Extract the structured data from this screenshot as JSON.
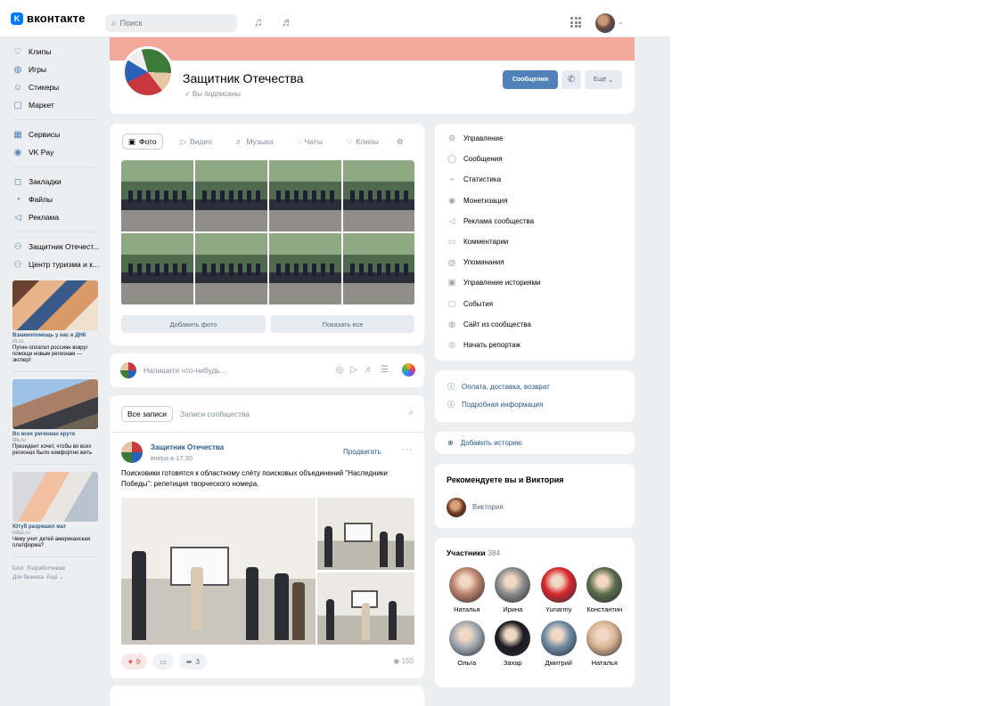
{
  "header": {
    "logo_mark": "K",
    "logo_text": "вконтакте",
    "search_placeholder": "Поиск"
  },
  "sidebar": {
    "items": [
      {
        "label": "Клипы",
        "icon": "clips-icon"
      },
      {
        "label": "Игры",
        "icon": "gamepad-icon"
      },
      {
        "label": "Стикеры",
        "icon": "sticker-icon"
      },
      {
        "label": "Маркет",
        "icon": "bag-icon"
      },
      {
        "label": "Сервисы",
        "icon": "grid-icon"
      },
      {
        "label": "VK Pay",
        "icon": "pay-icon"
      },
      {
        "label": "Закладки",
        "icon": "bookmark-icon"
      },
      {
        "label": "Файлы",
        "icon": "file-icon"
      },
      {
        "label": "Реклама",
        "icon": "megaphone-icon"
      },
      {
        "label": "Защитник Отечест...",
        "icon": "group-icon"
      },
      {
        "label": "Центр туризма и к...",
        "icon": "group-icon"
      }
    ],
    "ads": [
      {
        "title": "Взаимопомощь у нас в ДНК",
        "host": "rb.ru",
        "desc": "Путин оплатил россиян вокруг помощи новым регионам — эксперт"
      },
      {
        "title": "Во всех регионах круто",
        "host": "life.ru",
        "desc": "Президент хочет, чтобы во всех регионах было комфортно жить"
      },
      {
        "title": "Ютуб разрешил мат",
        "host": "ridus.ru",
        "desc": "Чему учит детей американская платформа?"
      }
    ],
    "footer": [
      "Блог",
      "Разработчикам",
      "Для бизнеса",
      "Ещё"
    ]
  },
  "group": {
    "name": "Защитник Отечества",
    "subscribed": "✓ Вы подписаны",
    "message_button": "Сообщения",
    "more_button": "Ещё"
  },
  "media_tabs": [
    "Фото",
    "Видео",
    "Музыка",
    "Чаты",
    "Клипы"
  ],
  "photos_buttons": {
    "add": "Добавить фото",
    "show_all": "Показать все"
  },
  "composer": {
    "placeholder": "Напишите что-нибудь..."
  },
  "wall": {
    "tab_all": "Все записи",
    "tab_community": "Записи сообщества",
    "post": {
      "author": "Защитник Отечества",
      "time": "вчера в 17:30",
      "promote": "Продвигать",
      "text": "Поисковики готовятся к областному слёту поисковых объединений \"Наследники Победы\": репетиция творческого номера.",
      "likes": "9",
      "shares": "3",
      "views": "150"
    }
  },
  "management": [
    {
      "label": "Управление",
      "icon": "gear-icon"
    },
    {
      "label": "Сообщения",
      "icon": "chat-icon"
    },
    {
      "label": "Статистика",
      "icon": "stats-icon"
    },
    {
      "label": "Монетизация",
      "icon": "coin-icon"
    },
    {
      "label": "Реклама сообщества",
      "icon": "megaphone-icon"
    },
    {
      "label": "Комментарии",
      "icon": "comment-icon"
    },
    {
      "label": "Упоминания",
      "icon": "at-icon"
    },
    {
      "label": "Управление историями",
      "icon": "story-icon"
    },
    {
      "label": "События",
      "icon": "calendar-icon"
    },
    {
      "label": "Сайт из сообщества",
      "icon": "globe-icon"
    },
    {
      "label": "Начать репортаж",
      "icon": "broadcast-icon"
    }
  ],
  "info": {
    "delivery": "Оплата, доставка, возврат",
    "details": "Подробная информация"
  },
  "story": {
    "add": "Добавить историю"
  },
  "recommend": {
    "title": "Рекомендуете вы и Виктория",
    "name": "Виктория"
  },
  "members": {
    "title": "Участники",
    "count": "384",
    "list": [
      {
        "name": "Наталья",
        "color": "#b8806a"
      },
      {
        "name": "Ирина",
        "color": "#8a8a8a"
      },
      {
        "name": "Yunarmy",
        "color": "#d8262e"
      },
      {
        "name": "Константин",
        "color": "#5b6b4a"
      },
      {
        "name": "Ольга",
        "color": "#a0a8b0"
      },
      {
        "name": "Захар",
        "color": "#1a1a1f"
      },
      {
        "name": "Дмитрий",
        "color": "#6d8aa3"
      },
      {
        "name": "Наталья",
        "color": "#d7b28f"
      }
    ]
  }
}
